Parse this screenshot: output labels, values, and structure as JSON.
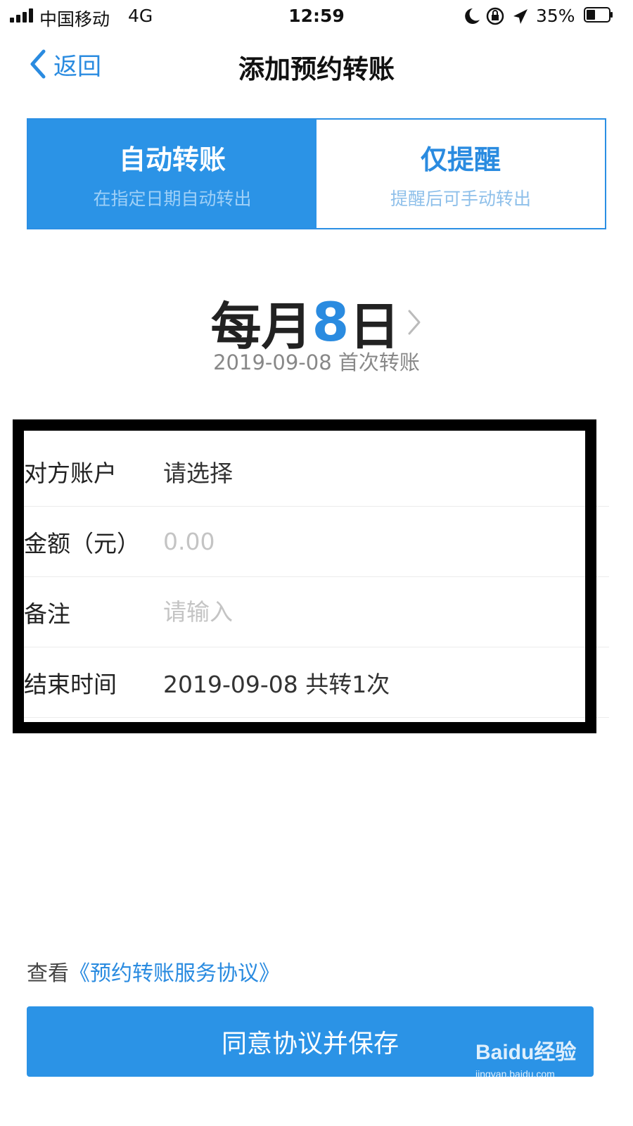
{
  "status_bar": {
    "carrier": "中国移动",
    "network": "4G",
    "time": "12:59",
    "battery": "35%"
  },
  "nav": {
    "back_label": "返回",
    "title": "添加预约转账"
  },
  "mode_tabs": [
    {
      "title": "自动转账",
      "subtitle": "在指定日期自动转出",
      "active": true
    },
    {
      "title": "仅提醒",
      "subtitle": "提醒后可手动转出",
      "active": false
    }
  ],
  "schedule": {
    "prefix": "每月",
    "day": "8",
    "suffix": "日",
    "first_transfer": "2019-09-08 首次转账"
  },
  "form": {
    "payee": {
      "label": "对方账户",
      "value": "请选择"
    },
    "amount": {
      "label": "金额（元）",
      "placeholder": "0.00"
    },
    "note": {
      "label": "备注",
      "placeholder": "请输入"
    },
    "end_time": {
      "label": "结束时间",
      "value": "2019-09-08 共转1次"
    }
  },
  "agreement": {
    "prefix": "查看",
    "link": "《预约转账服务协议》"
  },
  "save_button": "同意协议并保存",
  "watermark": {
    "logo": "Baidu经验",
    "url": "jingyan.baidu.com"
  },
  "colors": {
    "accent": "#2b93e6",
    "highlight_frame": "#000000"
  }
}
